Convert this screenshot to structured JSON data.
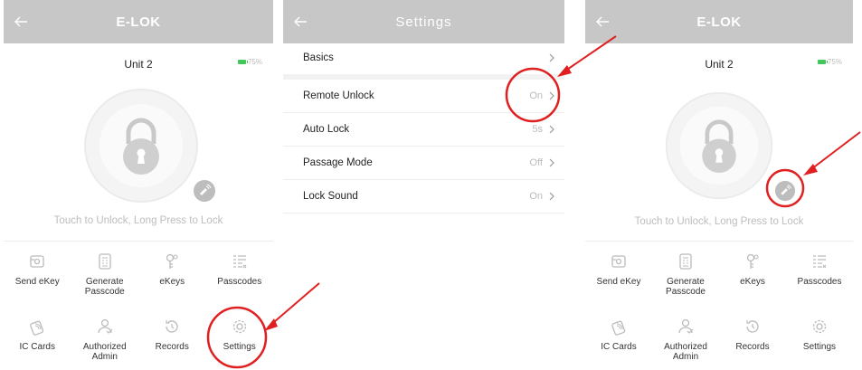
{
  "screen_left": {
    "header_title": "E-LOK",
    "unit_name": "Unit 2",
    "battery": "75%",
    "hint": "Touch to Unlock, Long Press to Lock",
    "grid": [
      {
        "label": "Send eKey",
        "icon": "send-ekey-icon"
      },
      {
        "label": "Generate\nPasscode",
        "icon": "generate-passcode-icon"
      },
      {
        "label": "eKeys",
        "icon": "ekeys-icon"
      },
      {
        "label": "Passcodes",
        "icon": "passcodes-icon"
      },
      {
        "label": "IC Cards",
        "icon": "ic-cards-icon"
      },
      {
        "label": "Authorized\nAdmin",
        "icon": "authorized-admin-icon"
      },
      {
        "label": "Records",
        "icon": "records-icon"
      },
      {
        "label": "Settings",
        "icon": "settings-icon"
      }
    ]
  },
  "screen_settings": {
    "header_title": "Settings",
    "rows": [
      {
        "label": "Basics",
        "value": ""
      },
      {
        "label": "Remote Unlock",
        "value": "On"
      },
      {
        "label": "Auto Lock",
        "value": "5s"
      },
      {
        "label": "Passage Mode",
        "value": "Off"
      },
      {
        "label": "Lock Sound",
        "value": "On"
      }
    ]
  },
  "screen_right": {
    "header_title": "E-LOK",
    "unit_name": "Unit 2",
    "battery": "75%",
    "hint": "Touch to Unlock, Long Press to Lock",
    "grid": [
      {
        "label": "Send eKey",
        "icon": "send-ekey-icon"
      },
      {
        "label": "Generate\nPasscode",
        "icon": "generate-passcode-icon"
      },
      {
        "label": "eKeys",
        "icon": "ekeys-icon"
      },
      {
        "label": "Passcodes",
        "icon": "passcodes-icon"
      },
      {
        "label": "IC Cards",
        "icon": "ic-cards-icon"
      },
      {
        "label": "Authorized\nAdmin",
        "icon": "authorized-admin-icon"
      },
      {
        "label": "Records",
        "icon": "records-icon"
      },
      {
        "label": "Settings",
        "icon": "settings-icon"
      }
    ]
  },
  "colors": {
    "header": "#c7c7c7",
    "annotation": "#e02020",
    "battery": "#44c75a",
    "muted_text": "#bdbdbd"
  }
}
